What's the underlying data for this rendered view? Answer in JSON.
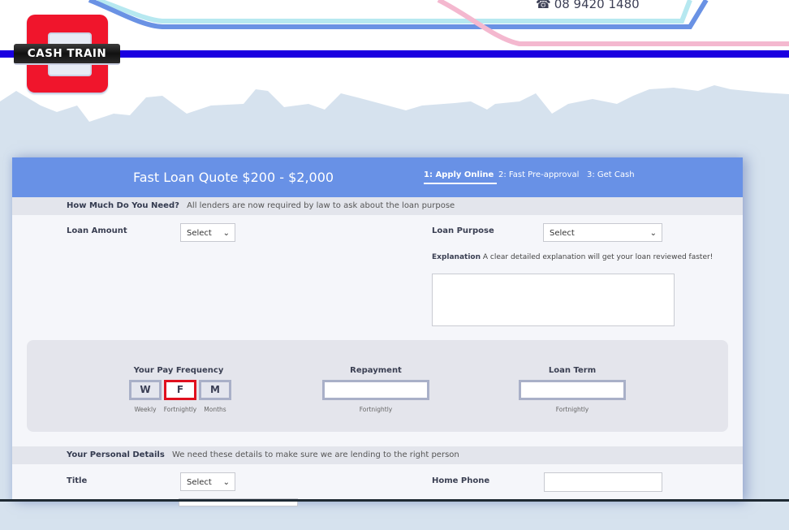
{
  "header": {
    "logo_text": "CASH TRAIN",
    "phone_icon": "telephone-icon",
    "phone": "08 9420 1480"
  },
  "form": {
    "title": "Fast Loan Quote $200 - $2,000",
    "steps": [
      {
        "label": "1: Apply Online",
        "active": true
      },
      {
        "label": "2: Fast Pre-approval",
        "active": false
      },
      {
        "label": "3: Get Cash",
        "active": false
      }
    ],
    "section1": {
      "heading": "How Much Do You Need?",
      "note": "All lenders are now required by law to ask about the loan purpose"
    },
    "loan_amount": {
      "label": "Loan Amount",
      "value": "Select"
    },
    "loan_purpose": {
      "label": "Loan Purpose",
      "value": "Select"
    },
    "explanation": {
      "label": "Explanation",
      "hint": "A clear detailed explanation will get your loan reviewed faster!",
      "value": ""
    },
    "calculator": {
      "pay_frequency": {
        "label": "Your Pay Frequency",
        "options": [
          {
            "key": "W",
            "sub": "Weekly",
            "selected": false
          },
          {
            "key": "F",
            "sub": "Fortnightly",
            "selected": true
          },
          {
            "key": "M",
            "sub": "Months",
            "selected": false
          }
        ]
      },
      "repayment": {
        "label": "Repayment",
        "value": "",
        "sub": "Fortnightly"
      },
      "loan_term": {
        "label": "Loan Term",
        "value": "",
        "sub": "Fortnightly"
      }
    },
    "section2": {
      "heading": "Your Personal Details",
      "note": "We need these details to make sure we are lending to the right person"
    },
    "title_field": {
      "label": "Title",
      "value": "Select"
    },
    "home_phone": {
      "label": "Home Phone",
      "value": ""
    }
  },
  "colors": {
    "header_blue": "#6891e6",
    "selected_border": "#e0101e",
    "brand_red": "#f0152c",
    "rail_blue": "#1a00e0"
  }
}
